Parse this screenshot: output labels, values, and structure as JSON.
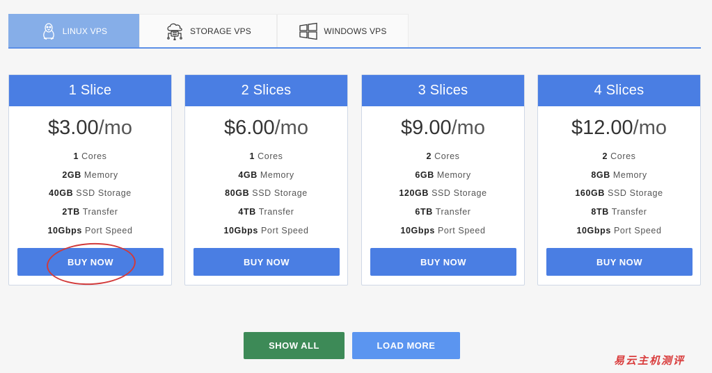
{
  "tabs": [
    {
      "label": "LINUX VPS",
      "icon": "tux-penguin-icon",
      "active": true
    },
    {
      "label": "STORAGE VPS",
      "icon": "cloud-storage-icon",
      "active": false
    },
    {
      "label": "WINDOWS VPS",
      "icon": "windows-logo-icon",
      "active": false
    }
  ],
  "plans": [
    {
      "name": "1 Slice",
      "price": "$3.00",
      "period": "/mo",
      "cores_v": "1",
      "cores_l": "Cores",
      "mem_v": "2GB",
      "mem_l": "Memory",
      "storage_v": "40GB",
      "storage_l": "SSD Storage",
      "transfer_v": "2TB",
      "transfer_l": "Transfer",
      "speed_v": "10Gbps",
      "speed_l": "Port Speed",
      "button": "BUY NOW"
    },
    {
      "name": "2 Slices",
      "price": "$6.00",
      "period": "/mo",
      "cores_v": "1",
      "cores_l": "Cores",
      "mem_v": "4GB",
      "mem_l": "Memory",
      "storage_v": "80GB",
      "storage_l": "SSD Storage",
      "transfer_v": "4TB",
      "transfer_l": "Transfer",
      "speed_v": "10Gbps",
      "speed_l": "Port Speed",
      "button": "BUY NOW"
    },
    {
      "name": "3 Slices",
      "price": "$9.00",
      "period": "/mo",
      "cores_v": "2",
      "cores_l": "Cores",
      "mem_v": "6GB",
      "mem_l": "Memory",
      "storage_v": "120GB",
      "storage_l": "SSD Storage",
      "transfer_v": "6TB",
      "transfer_l": "Transfer",
      "speed_v": "10Gbps",
      "speed_l": "Port Speed",
      "button": "BUY NOW"
    },
    {
      "name": "4 Slices",
      "price": "$12.00",
      "period": "/mo",
      "cores_v": "2",
      "cores_l": "Cores",
      "mem_v": "8GB",
      "mem_l": "Memory",
      "storage_v": "160GB",
      "storage_l": "SSD Storage",
      "transfer_v": "8TB",
      "transfer_l": "Transfer",
      "speed_v": "10Gbps",
      "speed_l": "Port Speed",
      "button": "BUY NOW"
    }
  ],
  "actions": {
    "show_all": "SHOW ALL",
    "load_more": "LOAD MORE"
  },
  "watermark": "易云主机测评",
  "colors": {
    "primary": "#4a7ee3",
    "active_tab": "#86aee8",
    "show_all": "#3d8a57",
    "load_more": "#5b95f0",
    "annotation": "#d23a3a"
  }
}
